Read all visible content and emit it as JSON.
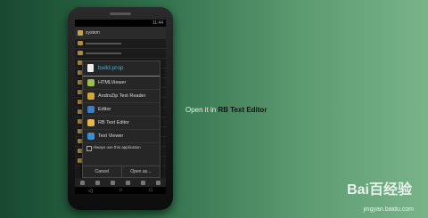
{
  "status_time": "11:44",
  "app_title": "system",
  "file_rows": [
    "",
    "",
    "",
    "",
    "",
    "",
    "",
    "",
    "",
    "",
    "",
    "",
    ""
  ],
  "dialog": {
    "title": "build.prop",
    "options": [
      {
        "label": "HTMLViewer",
        "icon": "android-icon",
        "color": "#9bc24a"
      },
      {
        "label": "AndroZip Text Reader",
        "icon": "folder-icon",
        "color": "#d4a33a"
      },
      {
        "label": "Editor",
        "icon": "editor-icon",
        "color": "#3b7fc4"
      },
      {
        "label": "RB Text Editor",
        "icon": "pencil-icon",
        "color": "#e7b643"
      },
      {
        "label": "Text Viewer",
        "icon": "document-icon",
        "color": "#3a8fd0"
      }
    ],
    "always_label": "Always use this application",
    "cancel_label": "Cancel",
    "open_label": "Open as..."
  },
  "nav": {
    "back": "◁",
    "home": "○",
    "recent": "□"
  },
  "tagline_prefix": "Open it in ",
  "tagline_bold": "RB Text Editor",
  "watermark": "Bai百经验",
  "watermark_url": "jingyan.baidu.com"
}
